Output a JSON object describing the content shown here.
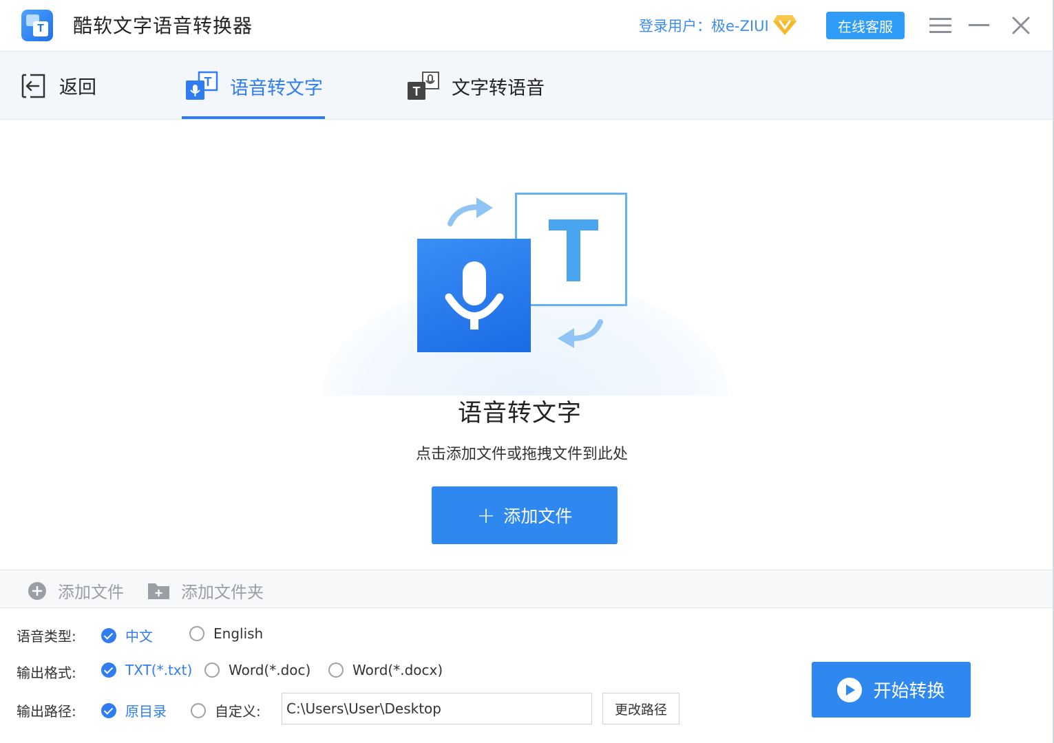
{
  "app": {
    "title": "酷软文字语音转换器",
    "user_label": "登录用户：极e-ZIUI",
    "service_label": "在线客服",
    "accent_color": "#2f7df0"
  },
  "nav": {
    "back_label": "返回",
    "tabs": [
      {
        "label": "语音转文字",
        "active": true
      },
      {
        "label": "文字转语音",
        "active": false
      }
    ]
  },
  "drop": {
    "title": "语音转文字",
    "hint": "点击添加文件或拖拽文件到此处",
    "add_button": "添加文件",
    "icon_letter": "T"
  },
  "toolbar": {
    "add_file": "添加文件",
    "add_folder": "添加文件夹"
  },
  "options": {
    "language": {
      "label": "语音类型:",
      "choices": [
        {
          "label": "中文",
          "checked": true
        },
        {
          "label": "English",
          "checked": false
        }
      ]
    },
    "format": {
      "label": "输出格式:",
      "choices": [
        {
          "label": "TXT(*.txt)",
          "checked": true
        },
        {
          "label": "Word(*.doc)",
          "checked": false
        },
        {
          "label": "Word(*.docx)",
          "checked": false
        }
      ]
    },
    "path": {
      "label": "输出路径:",
      "choices": [
        {
          "label": "原目录",
          "checked": true
        },
        {
          "label": "自定义:",
          "checked": false
        }
      ],
      "value": "C:\\Users\\User\\Desktop",
      "change_button": "更改路径"
    },
    "start_button": "开始转换"
  }
}
